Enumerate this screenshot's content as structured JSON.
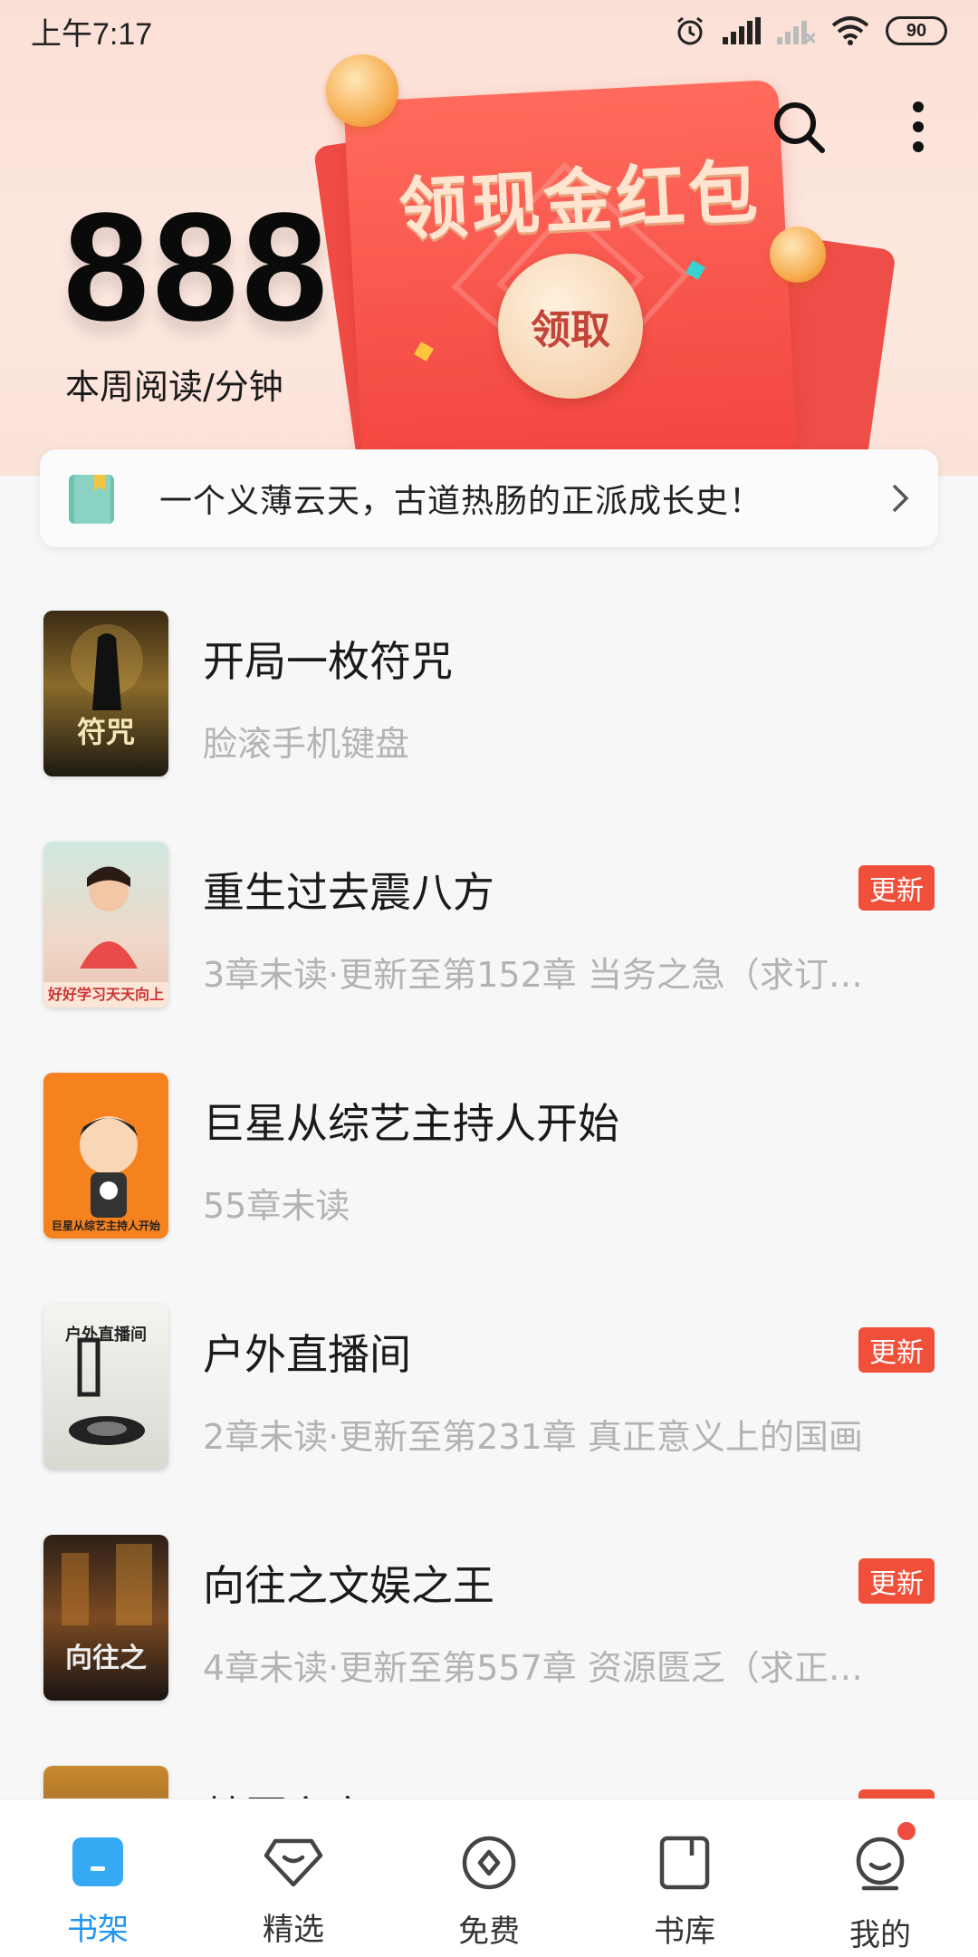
{
  "status_bar": {
    "time": "上午7:17",
    "battery": "90"
  },
  "header": {
    "reading_minutes": "888",
    "reading_label": "本周阅读/分钟",
    "envelope_title": "领现金红包",
    "envelope_button": "领取",
    "icons": [
      "search-icon",
      "more-vertical-icon"
    ]
  },
  "promo": {
    "text": "一个义薄云天，古道热肠的正派成长史！",
    "icon": "book-icon"
  },
  "books": [
    {
      "title": "开局一枚符咒",
      "subtitle": "脸滚手机键盘",
      "badge": "",
      "cover_text": "符咒"
    },
    {
      "title": "重生过去震八方",
      "subtitle": "3章未读·更新至第152章 当务之急（求订…",
      "badge": "更新",
      "cover_text": "好好学习天天向上"
    },
    {
      "title": "巨星从综艺主持人开始",
      "subtitle": "55章未读",
      "badge": "",
      "cover_text": "巨星从综艺主持人开始"
    },
    {
      "title": "户外直播间",
      "subtitle": "2章未读·更新至第231章 真正意义上的国画",
      "badge": "更新",
      "cover_text": "户外直播间"
    },
    {
      "title": "向往之文娱之王",
      "subtitle": "4章未读·更新至第557章 资源匮乏（求正…",
      "badge": "更新",
      "cover_text": "向往之"
    },
    {
      "title": "梦魇之宫",
      "subtitle": "",
      "badge": "更新",
      "cover_text": ""
    }
  ],
  "bottom_nav": [
    {
      "label": "书架",
      "icon": "bookshelf-icon",
      "active": true
    },
    {
      "label": "精选",
      "icon": "diamond-icon",
      "active": false
    },
    {
      "label": "免费",
      "icon": "coin-icon",
      "active": false
    },
    {
      "label": "书库",
      "icon": "library-icon",
      "active": false
    },
    {
      "label": "我的",
      "icon": "profile-icon",
      "active": false
    }
  ],
  "colors": {
    "accent": "#2196f3",
    "badge": "#f0503a",
    "envelope": "#f2453f"
  }
}
